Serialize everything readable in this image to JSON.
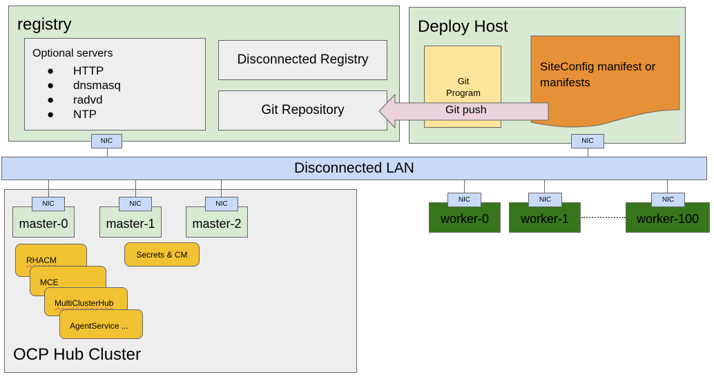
{
  "registry": {
    "title": "registry",
    "optional_servers": {
      "heading": "Optional servers",
      "items": [
        "HTTP",
        "dnsmasq",
        "radvd",
        "NTP"
      ]
    },
    "disconnected_registry_label": "Disconnected Registry",
    "git_repository_label": "Git Repository",
    "nic_label": "NIC"
  },
  "deploy_host": {
    "title": "Deploy Host",
    "git_program_label": "Git Program",
    "siteconfig_label": "SiteConfig manifest or manifests",
    "nic_label": "NIC"
  },
  "git_push_arrow": {
    "label": "Git push"
  },
  "lan": {
    "label": "Disconnected LAN"
  },
  "hub_cluster": {
    "title": "OCP Hub Cluster",
    "masters": [
      {
        "name": "master-0",
        "nic": "NIC"
      },
      {
        "name": "master-1",
        "nic": "NIC"
      },
      {
        "name": "master-2",
        "nic": "NIC"
      }
    ],
    "operators": [
      "RHACM",
      "MCE",
      "MultiClusterHub",
      "AgentService ..."
    ],
    "secrets_label": "Secrets & CM"
  },
  "workers": [
    {
      "name": "worker-0",
      "nic": "NIC"
    },
    {
      "name": "worker-1",
      "nic": "NIC"
    },
    {
      "name": "worker-100",
      "nic": "NIC"
    }
  ],
  "colors": {
    "host_green": "#d9ead3",
    "box_grey": "#eeeeee",
    "nic_blue": "#c9daf8",
    "git_program_yellow": "#ffe599",
    "siteconfig_orange": "#e69138",
    "arrow_pink": "#ead1dc",
    "operator_gold": "#f1c232",
    "worker_green": "#38761d"
  }
}
